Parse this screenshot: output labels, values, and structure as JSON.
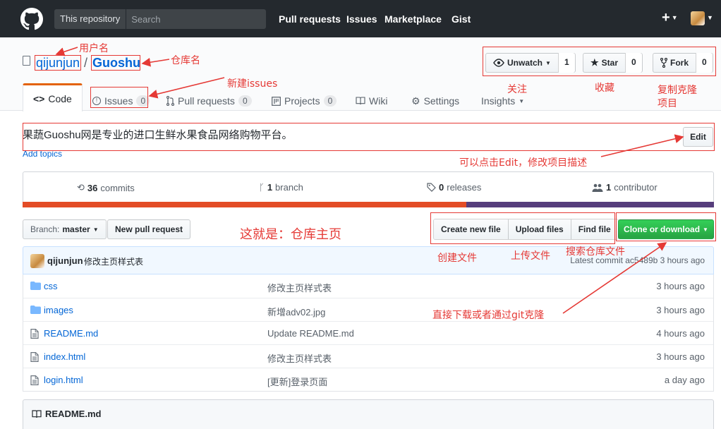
{
  "header": {
    "search_scope": "This repository",
    "search_placeholder": "Search",
    "nav": [
      "Pull requests",
      "Issues",
      "Marketplace",
      "Gist"
    ],
    "plus": "+"
  },
  "repo": {
    "owner": "qijunjun",
    "separator": "/",
    "name": "Guoshu",
    "watch_label": "Unwatch",
    "watch_count": "1",
    "star_label": "Star",
    "star_count": "0",
    "fork_label": "Fork",
    "fork_count": "0"
  },
  "tabs": {
    "code": "Code",
    "issues": "Issues",
    "issues_count": "0",
    "pulls": "Pull requests",
    "pulls_count": "0",
    "projects": "Projects",
    "projects_count": "0",
    "wiki": "Wiki",
    "settings": "Settings",
    "insights": "Insights"
  },
  "description": {
    "text": "果蔬Guoshu网是专业的进口生鲜水果食品网络购物平台。",
    "edit": "Edit",
    "add_topics": "Add topics"
  },
  "summary": {
    "commits_num": "36",
    "commits_label": "commits",
    "branch_num": "1",
    "branch_label": "branch",
    "releases_num": "0",
    "releases_label": "releases",
    "contributor_num": "1",
    "contributor_label": "contributor",
    "lang_colors": [
      "#e34c26",
      "#563d7c"
    ],
    "lang_share": [
      0.642,
      0.358
    ]
  },
  "filenav": {
    "branch_prefix": "Branch:",
    "branch": "master",
    "new_pr": "New pull request",
    "create_file": "Create new file",
    "upload_files": "Upload files",
    "find_file": "Find file",
    "clone": "Clone or download"
  },
  "commit": {
    "author": "qijunjun",
    "message": "修改主页样式表",
    "latest": "Latest commit ac5489b 3 hours ago"
  },
  "files": [
    {
      "type": "dir",
      "name": "css",
      "message": "修改主页样式表",
      "age": "3 hours ago"
    },
    {
      "type": "dir",
      "name": "images",
      "message": "新增adv02.jpg",
      "age": "3 hours ago"
    },
    {
      "type": "file",
      "name": "README.md",
      "message": "Update README.md",
      "age": "4 hours ago"
    },
    {
      "type": "file",
      "name": "index.html",
      "message": "修改主页样式表",
      "age": "3 hours ago"
    },
    {
      "type": "file",
      "name": "login.html",
      "message": "[更新]登录页面",
      "age": "a day ago"
    }
  ],
  "readme": {
    "title": "README.md"
  },
  "annotations": {
    "username": "用户名",
    "reponame": "仓库名",
    "new_issues": "新建issues",
    "watch": "关注",
    "star": "收藏",
    "fork_line1": "复制克隆",
    "fork_line2": "项目",
    "edit_desc": "可以点击Edit，修改项目描述",
    "home": "这就是：仓库主页",
    "create_file": "创建文件",
    "upload_file": "上传文件",
    "search_file": "搜索仓库文件",
    "clone": "直接下载或者通过git克隆"
  }
}
